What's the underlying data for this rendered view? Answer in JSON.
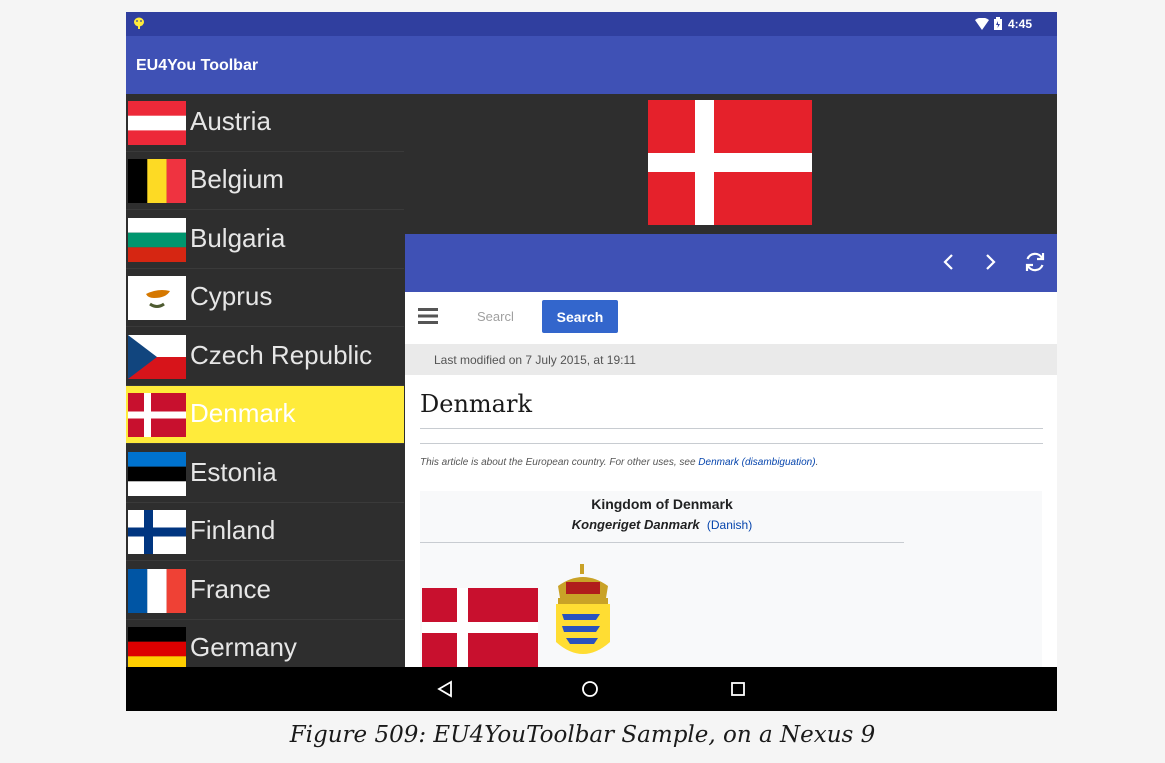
{
  "status_bar": {
    "time": "4:45",
    "notification_icon": "android-icon",
    "wifi_icon": "wifi-icon",
    "battery_icon": "battery-icon"
  },
  "app_bar": {
    "title": "EU4You Toolbar"
  },
  "countries": [
    {
      "name": "Austria",
      "flag": "flag-austria"
    },
    {
      "name": "Belgium",
      "flag": "flag-belgium"
    },
    {
      "name": "Bulgaria",
      "flag": "flag-bulgaria"
    },
    {
      "name": "Cyprus",
      "flag": "flag-cyprus"
    },
    {
      "name": "Czech Republic",
      "flag": "flag-czech-republic"
    },
    {
      "name": "Denmark",
      "flag": "flag-denmark",
      "selected": true
    },
    {
      "name": "Estonia",
      "flag": "flag-estonia"
    },
    {
      "name": "Finland",
      "flag": "flag-finland"
    },
    {
      "name": "France",
      "flag": "flag-france"
    },
    {
      "name": "Germany",
      "flag": "flag-germany"
    }
  ],
  "detail": {
    "web_toolbar": {
      "back_icon": "chevron-left-icon",
      "forward_icon": "chevron-right-icon",
      "reload_icon": "reload-icon"
    },
    "web": {
      "search_placeholder": "Searcl",
      "search_button": "Search",
      "last_modified": "Last modified on 7 July 2015, at 19:11",
      "page_title": "Denmark",
      "hatnote_text": "This article is about the European country. For other uses, see ",
      "hatnote_link": "Denmark (disambiguation)",
      "hatnote_end": ".",
      "infobox_title": "Kingdom of Denmark",
      "infobox_native_name": "Kongeriget Danmark",
      "infobox_language": "(Danish)"
    }
  },
  "nav_bar": {
    "back_icon": "back-triangle-icon",
    "home_icon": "home-circle-icon",
    "recents_icon": "recents-square-icon"
  },
  "caption": "Figure 509: EU4YouToolbar Sample, on a Nexus 9",
  "colors": {
    "primary": "#3f51b5",
    "primary_dark": "#303f9f",
    "selected_row": "#ffeb3b",
    "list_bg": "#2e2e2e"
  }
}
